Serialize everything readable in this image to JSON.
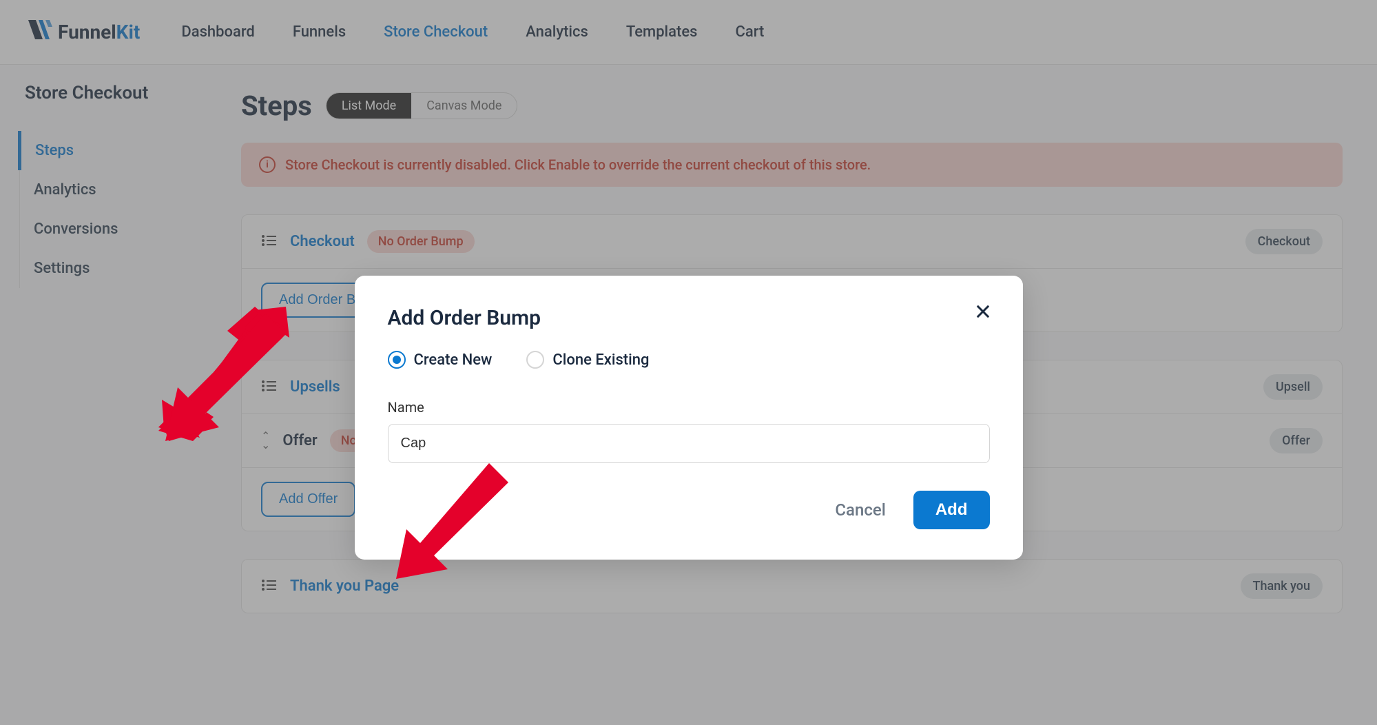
{
  "logo": {
    "funnel": "Funnel",
    "kit": "Kit"
  },
  "nav": {
    "dashboard": "Dashboard",
    "funnels": "Funnels",
    "store_checkout": "Store Checkout",
    "analytics": "Analytics",
    "templates": "Templates",
    "cart": "Cart"
  },
  "sidebar": {
    "title": "Store Checkout",
    "steps": "Steps",
    "analytics": "Analytics",
    "conversions": "Conversions",
    "settings": "Settings"
  },
  "steps_header": {
    "title": "Steps",
    "list_mode": "List Mode",
    "canvas_mode": "Canvas Mode"
  },
  "alert": "Store Checkout is currently disabled. Click Enable to override the current checkout of this store.",
  "checkout_card": {
    "name": "Checkout",
    "badge": "No Order Bump",
    "tag": "Checkout",
    "action": "Add Order Bump"
  },
  "upsells_card": {
    "name": "Upsells",
    "tag": "Upsell",
    "offer_name": "Offer",
    "offer_badge": "No Produ",
    "offer_tag": "Offer",
    "action": "Add Offer"
  },
  "thankyou_card": {
    "name": "Thank you Page",
    "tag": "Thank you"
  },
  "modal": {
    "title": "Add Order Bump",
    "radio_create": "Create New",
    "radio_clone": "Clone Existing",
    "name_label": "Name",
    "name_value": "Cap",
    "cancel": "Cancel",
    "add": "Add"
  }
}
